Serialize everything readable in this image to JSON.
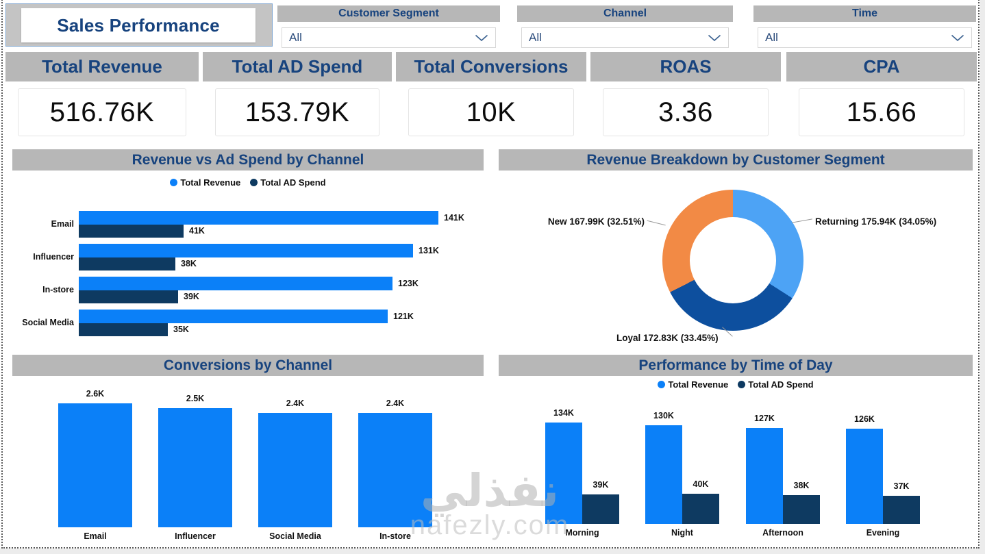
{
  "title": "Sales Performance",
  "filters": [
    {
      "label": "Customer Segment",
      "value": "All"
    },
    {
      "label": "Channel",
      "value": "All"
    },
    {
      "label": "Time",
      "value": "All"
    }
  ],
  "kpis": [
    {
      "label": "Total Revenue",
      "value": "516.76K"
    },
    {
      "label": "Total AD Spend",
      "value": "153.79K"
    },
    {
      "label": "Total Conversions",
      "value": "10K"
    },
    {
      "label": "ROAS",
      "value": "3.36"
    },
    {
      "label": "CPA",
      "value": "15.66"
    }
  ],
  "colors": {
    "accent_navy_text": "#17437e",
    "revenue_blue": "#0b80f8",
    "ad_spend_navy": "#0e3a61",
    "donut_returning": "#4da3f5",
    "donut_loyal": "#0d4f9e",
    "donut_new": "#f28a45",
    "panel_header_bg": "#b7b7b7"
  },
  "watermark": {
    "arabic": "نفذلي",
    "domain": "nafezly.com"
  },
  "chart_data": [
    {
      "type": "bar",
      "orientation": "horizontal",
      "title": "Revenue vs Ad Spend by Channel",
      "categories": [
        "Email",
        "Influencer",
        "In-store",
        "Social Media"
      ],
      "series": [
        {
          "name": "Total Revenue",
          "values": [
            141,
            131,
            123,
            121
          ],
          "labels": [
            "141K",
            "131K",
            "123K",
            "121K"
          ],
          "color": "#0b80f8"
        },
        {
          "name": "Total AD Spend",
          "values": [
            41,
            38,
            39,
            35
          ],
          "labels": [
            "41K",
            "38K",
            "39K",
            "35K"
          ],
          "color": "#0e3a61"
        }
      ],
      "unit": "K",
      "legend_position": "top",
      "axes_hidden": true
    },
    {
      "type": "pie",
      "subtype": "donut",
      "title": "Revenue Breakdown by Customer Segment",
      "slices": [
        {
          "name": "Returning",
          "value": 175.94,
          "pct": 34.05,
          "label": "Returning 175.94K (34.05%)",
          "color": "#4da3f5"
        },
        {
          "name": "Loyal",
          "value": 172.83,
          "pct": 33.45,
          "label": "Loyal 172.83K (33.45%)",
          "color": "#0d4f9e"
        },
        {
          "name": "New",
          "value": 167.99,
          "pct": 32.51,
          "label": "New 167.99K (32.51%)",
          "color": "#f28a45"
        }
      ],
      "unit": "K",
      "start_angle_deg": 0,
      "clockwise": true
    },
    {
      "type": "bar",
      "orientation": "vertical",
      "title": "Conversions by Channel",
      "categories": [
        "Email",
        "Influencer",
        "Social Media",
        "In-store"
      ],
      "values": [
        2.6,
        2.5,
        2.4,
        2.4
      ],
      "labels": [
        "2.6K",
        "2.5K",
        "2.4K",
        "2.4K"
      ],
      "color": "#0b80f8",
      "ylim": [
        0,
        2.6
      ],
      "axes_hidden": true
    },
    {
      "type": "bar",
      "orientation": "vertical",
      "grouped": true,
      "title": "Performance by Time of Day",
      "categories": [
        "Morning",
        "Night",
        "Afternoon",
        "Evening"
      ],
      "series": [
        {
          "name": "Total Revenue",
          "values": [
            134,
            130,
            127,
            126
          ],
          "labels": [
            "134K",
            "130K",
            "127K",
            "126K"
          ],
          "color": "#0b80f8"
        },
        {
          "name": "Total AD Spend",
          "values": [
            39,
            40,
            38,
            37
          ],
          "labels": [
            "39K",
            "40K",
            "38K",
            "37K"
          ],
          "color": "#0e3a61"
        }
      ],
      "unit": "K",
      "legend_position": "top",
      "ylim": [
        0,
        134
      ],
      "axes_hidden": true
    }
  ]
}
